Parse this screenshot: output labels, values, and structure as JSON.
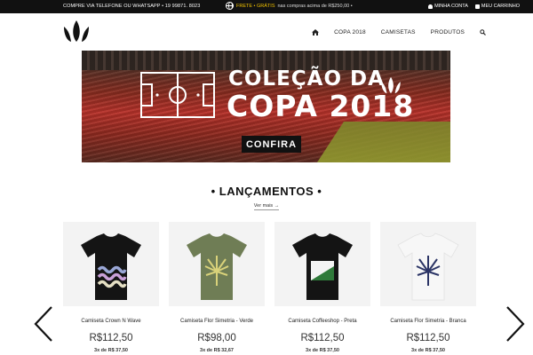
{
  "topbar": {
    "contact": "COMPRE VIA TELEFONE OU WHATSAPP • 19 99871. 8023",
    "frete_label": "FRETE • GRÁTIS",
    "frete_condition": "nas compras acima de R$250,00 •",
    "account": "MINHA CONTA",
    "cart": "MEU CARRINHO"
  },
  "nav": {
    "items": [
      {
        "label": "COPA 2018"
      },
      {
        "label": "CAMISETAS"
      },
      {
        "label": "PRODUTOS"
      }
    ]
  },
  "banner": {
    "line1": "COLEÇÃO DA",
    "line2": "COPA 2018",
    "cta": "CONFIRA"
  },
  "section": {
    "title": "• LANÇAMENTOS •",
    "more": "Ver mais →"
  },
  "products": [
    {
      "name": "Camiseta Crown N Wave",
      "price": "R$112,50",
      "installments": "3x de R$ 37,50",
      "shirt_color": "#141414"
    },
    {
      "name": "Camiseta Flor Simetria - Verde",
      "price": "R$98,00",
      "installments": "3x de R$ 32,67",
      "shirt_color": "#6f7d55"
    },
    {
      "name": "Camiseta Coffeeshop - Preta",
      "price": "R$112,50",
      "installments": "3x de R$ 37,50",
      "shirt_color": "#141414"
    },
    {
      "name": "Camiseta Flor Simetria - Branca",
      "price": "R$112,50",
      "installments": "3x de R$ 37,50",
      "shirt_color": "#f7f7f7"
    }
  ],
  "icons": {
    "home": "home-icon",
    "search": "search-icon",
    "prev": "chevron-left-icon",
    "next": "chevron-right-icon"
  },
  "colors": {
    "topbar_bg": "#111111",
    "frete_accent": "#f2c200"
  }
}
